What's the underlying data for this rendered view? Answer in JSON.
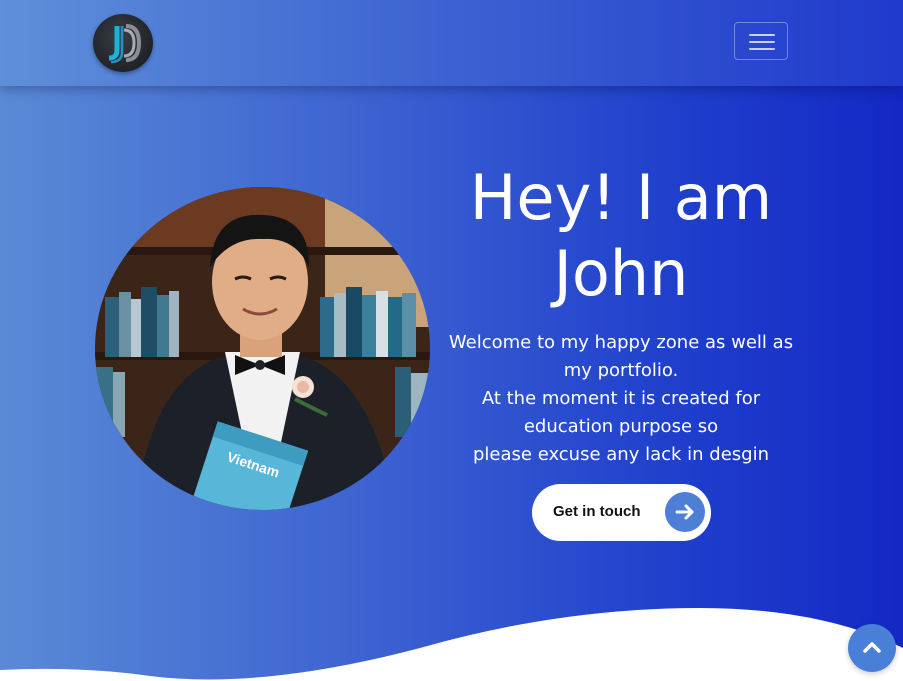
{
  "navbar": {
    "logo_icon": "jd-monogram-logo",
    "toggler_icon": "hamburger-menu-icon"
  },
  "hero": {
    "title_line1": "Hey! I am",
    "title_line2": "John",
    "intro_lines": [
      "Welcome to my happy zone as well as",
      "my portfolio.",
      "At the moment it is created for",
      "education purpose so",
      "please excuse any lack in desgin"
    ],
    "cta_label": "Get in touch",
    "cta_icon": "arrow-right-icon",
    "book_title": "Vietnam"
  },
  "scroll_top_icon": "chevron-up-icon",
  "colors": {
    "gradient_start": "#5a8ad6",
    "gradient_end": "#1428c4",
    "accent": "#4e7fd6",
    "button_bg": "#ffffff"
  }
}
